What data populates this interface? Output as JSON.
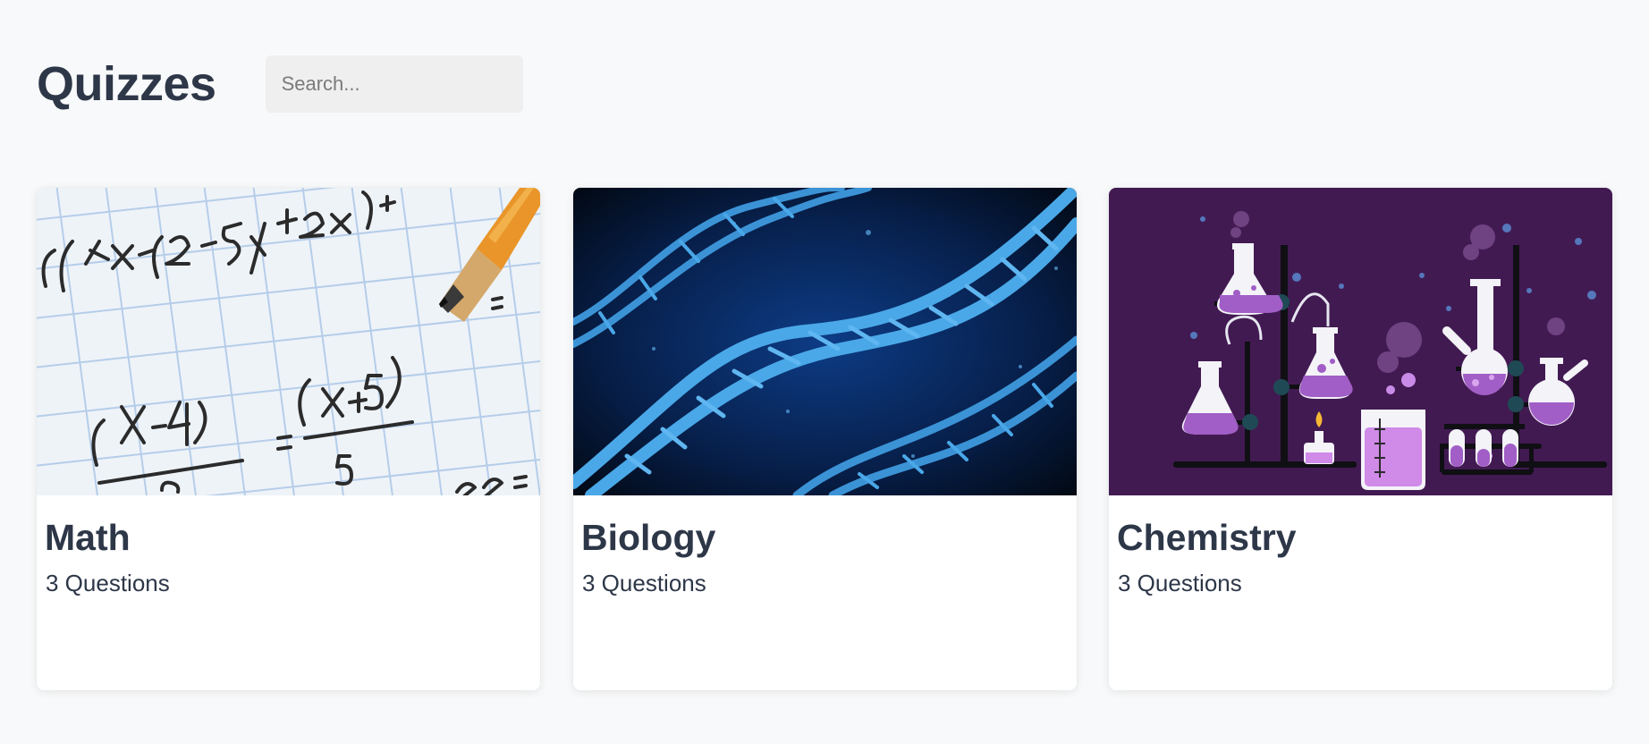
{
  "page": {
    "title": "Quizzes"
  },
  "search": {
    "placeholder": "Search...",
    "value": ""
  },
  "quizzes": [
    {
      "title": "Math",
      "questions": "3 Questions",
      "image": "math-worksheet-with-pencil"
    },
    {
      "title": "Biology",
      "questions": "3 Questions",
      "image": "blue-dna-double-helix"
    },
    {
      "title": "Chemistry",
      "questions": "3 Questions",
      "image": "purple-chemistry-lab-illustration"
    }
  ],
  "colors": {
    "text": "#2d3748",
    "search_bg": "#efefef",
    "chemistry_bg": "#421a52",
    "biology_bg": "#06224d",
    "dna": "#4aa8e8"
  }
}
